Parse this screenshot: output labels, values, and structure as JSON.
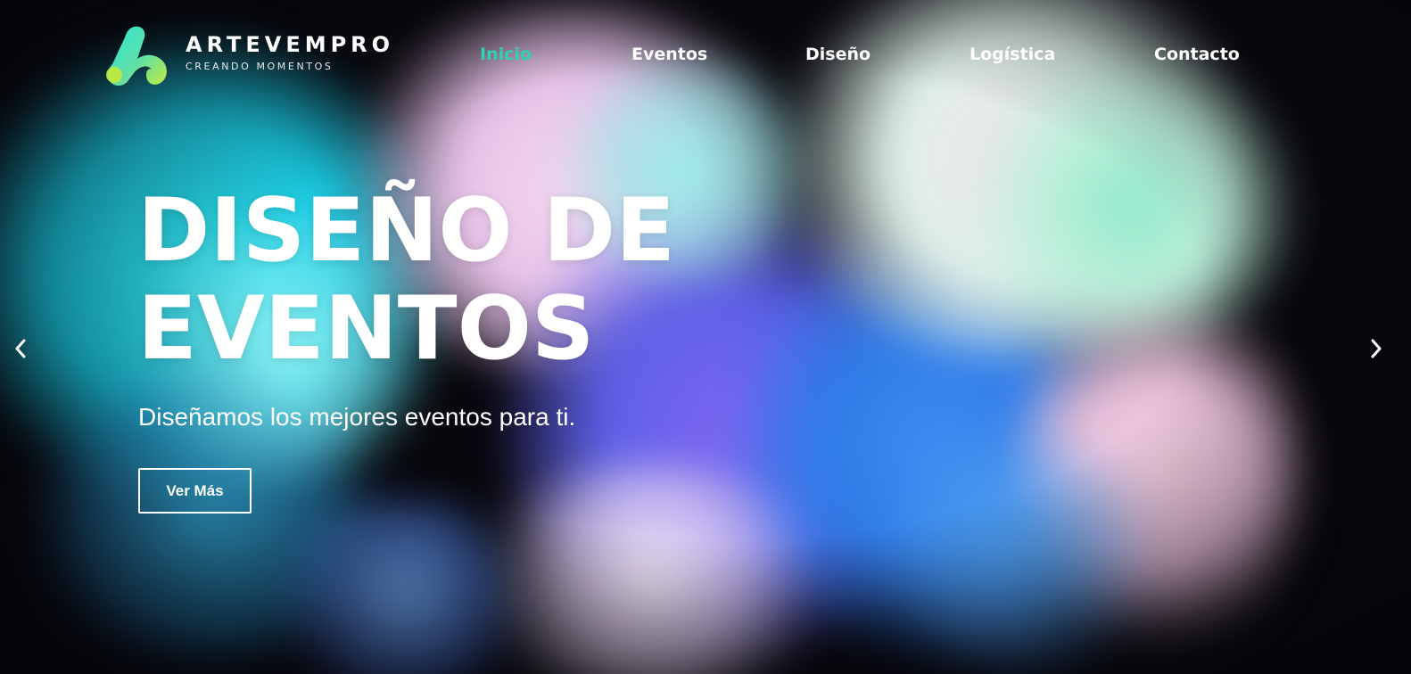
{
  "brand": {
    "name": "ARTEVEMPRO",
    "tagline": "CREANDO MOMENTOS",
    "logo_icon": "stylized-a-logo-icon",
    "gradient_colors": [
      "#2fe6d5",
      "#c3ea3c"
    ]
  },
  "nav": {
    "items": [
      {
        "label": "Inicio",
        "active": true
      },
      {
        "label": "Eventos",
        "active": false
      },
      {
        "label": "Diseño",
        "active": false
      },
      {
        "label": "Logística",
        "active": false
      },
      {
        "label": "Contacto",
        "active": false
      }
    ],
    "active_color": "#2ed1b2"
  },
  "hero": {
    "headline_line1": "DISEÑO DE",
    "headline_line2": "EVENTOS",
    "subtitle": "Diseñamos los mejores eventos para ti.",
    "cta_label": "Ver Más",
    "background": "colorful-ink-smoke-image"
  },
  "slider": {
    "prev_icon": "chevron-left-icon",
    "next_icon": "chevron-right-icon"
  }
}
